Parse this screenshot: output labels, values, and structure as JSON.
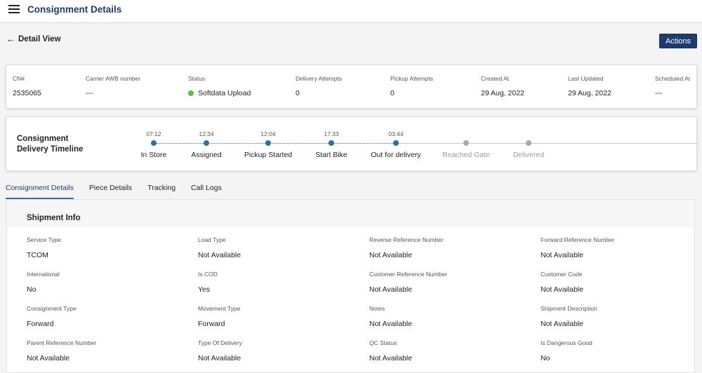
{
  "header": {
    "title": "Consignment Details"
  },
  "nav": {
    "back_label": "Detail View",
    "actions_label": "Actions"
  },
  "summary": [
    {
      "label": "CN#",
      "value": "2535065"
    },
    {
      "label": "Carrier AWB number",
      "value": "---"
    },
    {
      "label": "Status",
      "value": "Softdata Upload",
      "status_color": "#5fbf3c"
    },
    {
      "label": "Delivery Attempts",
      "value": "0"
    },
    {
      "label": "Pickup Attempts",
      "value": "0"
    },
    {
      "label": "Created At",
      "value": "29 Aug, 2022"
    },
    {
      "label": "Last Updated",
      "value": "29 Aug, 2022"
    },
    {
      "label": "Scheduled At",
      "value": "---"
    }
  ],
  "timeline": {
    "title": "Consignment Delivery Timeline",
    "steps": [
      {
        "time": "07:12",
        "label": "In Store",
        "completed": true
      },
      {
        "time": "12:34",
        "label": "Assigned",
        "completed": true
      },
      {
        "time": "12:04",
        "label": "Pickup Started",
        "completed": true
      },
      {
        "time": "17:33",
        "label": "Start Bike",
        "completed": true
      },
      {
        "time": "03:44",
        "label": "Out for delivery",
        "completed": true
      },
      {
        "time": "",
        "label": "Reached Gate",
        "completed": false
      },
      {
        "time": "",
        "label": "Delivered",
        "completed": false
      }
    ]
  },
  "tabs": [
    {
      "label": "Consignment Details",
      "active": true
    },
    {
      "label": "Piece Details",
      "active": false
    },
    {
      "label": "Tracking",
      "active": false
    },
    {
      "label": "Call Logs",
      "active": false
    }
  ],
  "shipment_info": {
    "title": "Shipment Info",
    "fields": [
      {
        "label": "Service Type",
        "value": "TCOM"
      },
      {
        "label": "Load Type",
        "value": "Not Available"
      },
      {
        "label": "Reverse Reference Number",
        "value": "Not Available"
      },
      {
        "label": "Forward Reference Number",
        "value": "Not Available"
      },
      {
        "label": "International",
        "value": "No"
      },
      {
        "label": "Is COD",
        "value": "Yes"
      },
      {
        "label": "Customer Reference Number",
        "value": "Not Available"
      },
      {
        "label": "Customer Code",
        "value": "Not Available"
      },
      {
        "label": "Consignment Type",
        "value": "Forward"
      },
      {
        "label": "Movement Type",
        "value": "Forward"
      },
      {
        "label": "Notes",
        "value": "Not Available"
      },
      {
        "label": "Shipment Description",
        "value": "Not Available"
      },
      {
        "label": "Parent Reference Number",
        "value": "Not Available"
      },
      {
        "label": "Type Of Delivery",
        "value": "Not Available"
      },
      {
        "label": "QC Status",
        "value": "Not Available"
      },
      {
        "label": "Is Dangerous Good",
        "value": "No"
      }
    ]
  }
}
